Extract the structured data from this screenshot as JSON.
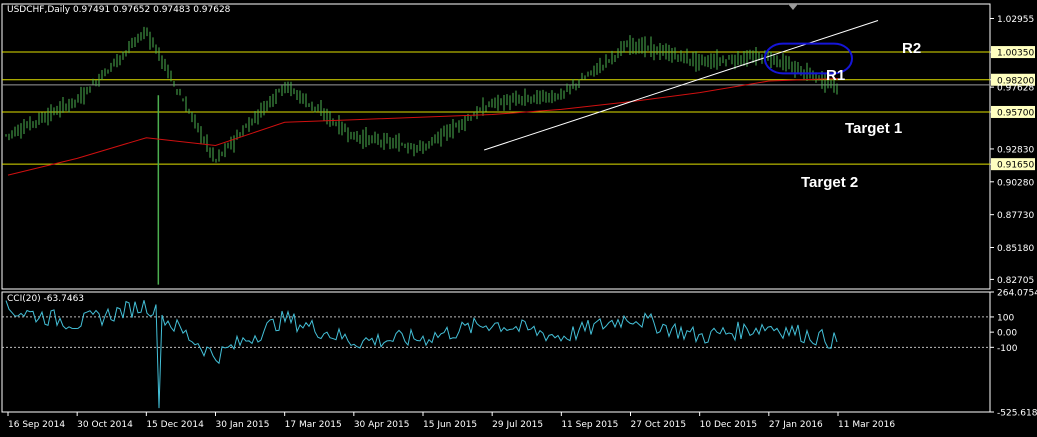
{
  "header": {
    "title": "USDCHF,Daily  0.97491 0.97652 0.97483 0.97628",
    "indicator_title": "CCI(20) -63.7463"
  },
  "annotations": {
    "r2": "R2",
    "r1": "R1",
    "target1": "Target 1",
    "target2": "Target 2"
  },
  "colors": {
    "background": "#000000",
    "candle": "#4caf50",
    "ma": "#d01010",
    "level_line": "#e0e000",
    "trendline": "#ffffff",
    "highlight": "#1515d8",
    "cci": "#44c0d8",
    "axis": "#ffffff",
    "label_bg": "#ffffc0"
  },
  "chart_data": [
    {
      "type": "candlestick",
      "title": "USDCHF,Daily",
      "ohlc_last": {
        "open": 0.97491,
        "high": 0.97652,
        "low": 0.97483,
        "close": 0.97628
      },
      "ylim": [
        0.8196,
        1.0408
      ],
      "y_ticks": [
        "1.02955",
        "1.00350",
        "0.98200",
        "0.97628",
        "0.95700",
        "0.92830",
        "0.91650",
        "0.90280",
        "0.87730",
        "0.85180",
        "0.82705"
      ],
      "y_tick_values": [
        1.02955,
        1.0035,
        0.982,
        0.97628,
        0.957,
        0.9283,
        0.9165,
        0.9028,
        0.8773,
        0.8518,
        0.82705
      ],
      "x_labels": [
        "16 Sep 2014",
        "30 Oct 2014",
        "15 Dec 2014",
        "30 Jan 2015",
        "17 Mar 2015",
        "30 Apr 2015",
        "15 Jun 2015",
        "29 Jul 2015",
        "11 Sep 2015",
        "27 Oct 2015",
        "10 Dec 2015",
        "27 Jan 2016",
        "11 Mar 2016"
      ],
      "levels": [
        {
          "name": "R2",
          "value": 1.0035
        },
        {
          "name": "R1",
          "value": 0.982
        },
        {
          "name": "Target 1",
          "value": 0.957
        },
        {
          "name": "Target 2",
          "value": 0.9165
        }
      ],
      "guide_line": 0.978,
      "close_path": [
        {
          "x": "16 Sep 2014",
          "y": 0.939
        },
        {
          "x": "30 Oct 2014",
          "y": 0.966
        },
        {
          "x": "15 Dec 2014",
          "y": 1.02
        },
        {
          "x": "30 Jan 2015",
          "y": 0.919
        },
        {
          "x": "17 Mar 2015",
          "y": 0.978
        },
        {
          "x": "30 Apr 2015",
          "y": 0.938
        },
        {
          "x": "15 Jun 2015",
          "y": 0.929
        },
        {
          "x": "29 Jul 2015",
          "y": 0.964
        },
        {
          "x": "11 Sep 2015",
          "y": 0.97
        },
        {
          "x": "27 Oct 2015",
          "y": 1.01
        },
        {
          "x": "10 Dec 2015",
          "y": 0.996
        },
        {
          "x": "27 Jan 2016",
          "y": 1.0
        },
        {
          "x": "11 Mar 2016",
          "y": 0.9763
        }
      ],
      "moving_average": [
        {
          "x": "16 Sep 2014",
          "y": 0.908
        },
        {
          "x": "30 Oct 2014",
          "y": 0.921
        },
        {
          "x": "15 Dec 2014",
          "y": 0.937
        },
        {
          "x": "30 Jan 2015",
          "y": 0.931
        },
        {
          "x": "17 Mar 2015",
          "y": 0.949
        },
        {
          "x": "30 Apr 2015",
          "y": 0.951
        },
        {
          "x": "15 Jun 2015",
          "y": 0.953
        },
        {
          "x": "29 Jul 2015",
          "y": 0.955
        },
        {
          "x": "11 Sep 2015",
          "y": 0.959
        },
        {
          "x": "27 Oct 2015",
          "y": 0.965
        },
        {
          "x": "10 Dec 2015",
          "y": 0.972
        },
        {
          "x": "27 Jan 2016",
          "y": 0.981
        },
        {
          "x": "11 Mar 2016",
          "y": 0.983
        }
      ],
      "trendline": [
        {
          "x": "29 Jul 2015",
          "y": 0.9275
        },
        {
          "x": "11 Mar 2016",
          "y": 1.028
        }
      ],
      "highlight_zone": {
        "x_from": "27 Jan 2016",
        "x_to": "11 Mar 2016",
        "y_from": 0.987,
        "y_to": 1.01
      }
    },
    {
      "type": "line",
      "title": "CCI(20)",
      "last_value": -63.7463,
      "ylim": [
        -525.6182,
        264.0754
      ],
      "y_ticks": [
        "264.0754",
        "100",
        "0.00",
        "-100",
        "-525.6182"
      ],
      "y_tick_values": [
        264.0754,
        100,
        0,
        -100,
        -525.6182
      ],
      "levels": [
        100,
        -100
      ],
      "series": [
        {
          "x": "16 Sep 2014",
          "y": 150
        },
        {
          "x": "30 Oct 2014",
          "y": 60
        },
        {
          "x": "15 Dec 2014",
          "y": 180
        },
        {
          "x": "30 Jan 2015",
          "y": -160
        },
        {
          "x": "17 Mar 2015",
          "y": 90
        },
        {
          "x": "30 Apr 2015",
          "y": -60
        },
        {
          "x": "15 Jun 2015",
          "y": -40
        },
        {
          "x": "29 Jul 2015",
          "y": 60
        },
        {
          "x": "11 Sep 2015",
          "y": -30
        },
        {
          "x": "27 Oct 2015",
          "y": 100
        },
        {
          "x": "10 Dec 2015",
          "y": -30
        },
        {
          "x": "27 Jan 2016",
          "y": 40
        },
        {
          "x": "11 Mar 2016",
          "y": -64
        }
      ]
    }
  ]
}
